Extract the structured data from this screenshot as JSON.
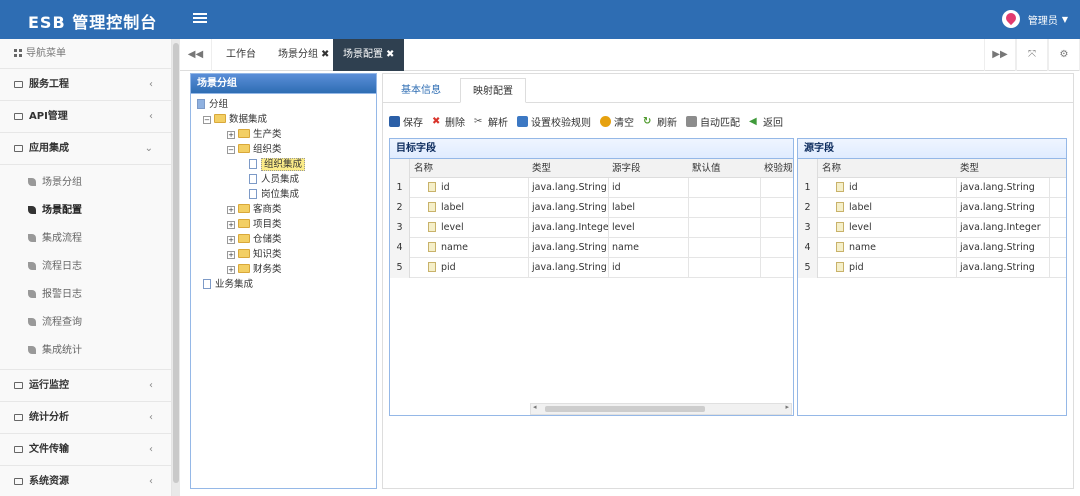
{
  "app": {
    "title": "ESB 管理控制台",
    "user": "管理员"
  },
  "sidebar": {
    "header": "导航菜单",
    "items": [
      {
        "label": "服务工程",
        "chevron": "‹"
      },
      {
        "label": "API管理",
        "chevron": "‹"
      },
      {
        "label": "应用集成",
        "chevron": "⌄"
      }
    ],
    "subitems": [
      {
        "label": "场景分组"
      },
      {
        "label": "场景配置",
        "active": true
      },
      {
        "label": "集成流程"
      },
      {
        "label": "流程日志"
      },
      {
        "label": "报警日志"
      },
      {
        "label": "流程查询"
      },
      {
        "label": "集成统计"
      }
    ],
    "items_after": [
      {
        "label": "运行监控",
        "chevron": "‹"
      },
      {
        "label": "统计分析",
        "chevron": "‹"
      },
      {
        "label": "文件传输",
        "chevron": "‹"
      },
      {
        "label": "系统资源",
        "chevron": "‹"
      }
    ]
  },
  "tabs": {
    "prev": "◀◀",
    "next": "▶▶",
    "items": [
      {
        "label": "工作台",
        "close": ""
      },
      {
        "label": "场景分组",
        "close": "✖"
      },
      {
        "label": "场景配置",
        "close": "✖"
      }
    ]
  },
  "tree": {
    "title": "场景分组",
    "root": "分组",
    "data_group": "数据集成",
    "nodes": {
      "sc": "生产类",
      "zz": "组织类",
      "zzjc": "组织集成",
      "ry": "人员集成",
      "gw": "岗位集成",
      "ks": "客商类",
      "xm": "项目类",
      "cc": "仓储类",
      "zs": "知识类",
      "cw": "财务类"
    },
    "business": "业务集成"
  },
  "main": {
    "tabs": [
      "基本信息",
      "映射配置"
    ],
    "toolbar": [
      {
        "label": "保存",
        "color": "#2b5fa7"
      },
      {
        "label": "删除",
        "color": "#d9342b"
      },
      {
        "label": "解析",
        "color": "#555555"
      },
      {
        "label": "设置校验规则",
        "color": "#3c78c3"
      },
      {
        "label": "清空",
        "color": "#e6a10f"
      },
      {
        "label": "刷新",
        "color": "#4f9a2d"
      },
      {
        "label": "自动匹配",
        "color": "#6d6d6d"
      },
      {
        "label": "返回",
        "color": "#3f9a3a"
      }
    ]
  },
  "target_grid": {
    "title": "目标字段",
    "columns": [
      "名称",
      "类型",
      "源字段",
      "默认值",
      "校验规"
    ],
    "rows": [
      {
        "n": "1",
        "name": "id",
        "type": "java.lang.String",
        "src": "id",
        "def": "",
        "rule": ""
      },
      {
        "n": "2",
        "name": "label",
        "type": "java.lang.String",
        "src": "label",
        "def": "",
        "rule": ""
      },
      {
        "n": "3",
        "name": "level",
        "type": "java.lang.Intege",
        "src": "level",
        "def": "",
        "rule": ""
      },
      {
        "n": "4",
        "name": "name",
        "type": "java.lang.String",
        "src": "name",
        "def": "",
        "rule": ""
      },
      {
        "n": "5",
        "name": "pid",
        "type": "java.lang.String",
        "src": "id",
        "def": "",
        "rule": ""
      }
    ]
  },
  "source_grid": {
    "title": "源字段",
    "columns": [
      "名称",
      "类型"
    ],
    "rows": [
      {
        "n": "1",
        "name": "id",
        "type": "java.lang.String"
      },
      {
        "n": "2",
        "name": "label",
        "type": "java.lang.String"
      },
      {
        "n": "3",
        "name": "level",
        "type": "java.lang.Integer"
      },
      {
        "n": "4",
        "name": "name",
        "type": "java.lang.String"
      },
      {
        "n": "5",
        "name": "pid",
        "type": "java.lang.String"
      }
    ]
  }
}
